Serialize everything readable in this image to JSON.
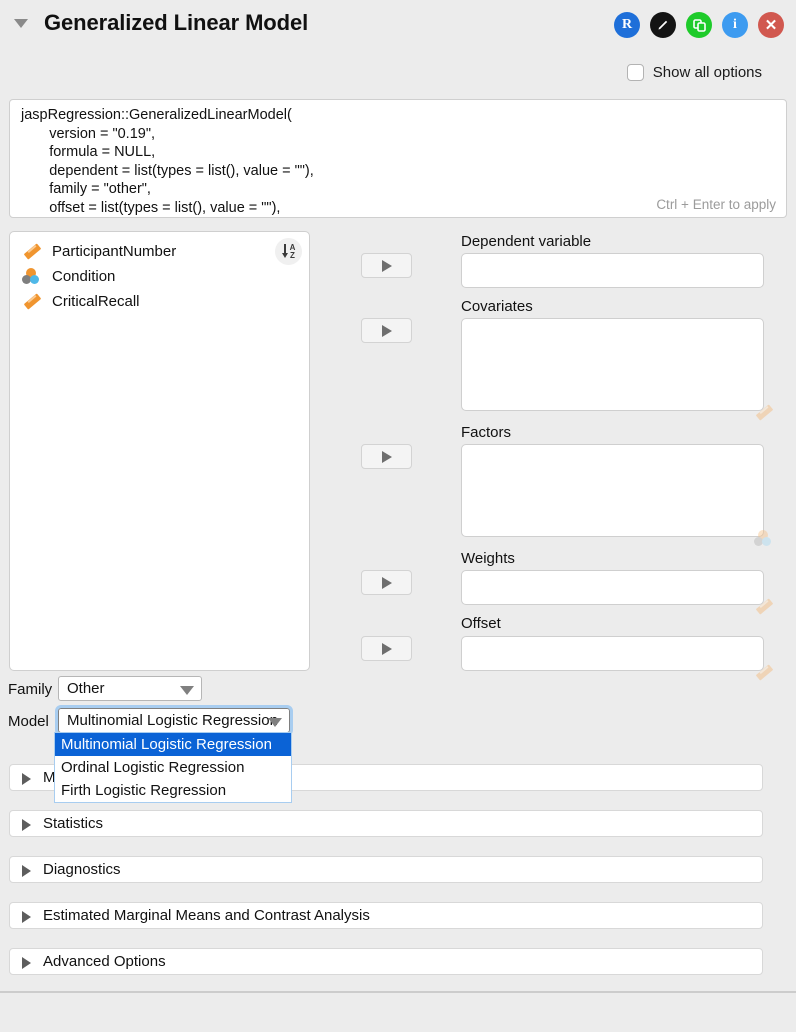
{
  "header": {
    "title": "Generalized Linear Model",
    "collapse_icon": "triangle-down-icon",
    "icons": [
      {
        "name": "r-syntax-icon",
        "glyph": "R",
        "color": "#1e6fd9"
      },
      {
        "name": "edit-pencil-icon",
        "glyph": "/",
        "color": "#141414"
      },
      {
        "name": "duplicate-icon",
        "glyph": "⧉",
        "color": "#1ecb2a"
      },
      {
        "name": "info-icon",
        "glyph": "i",
        "color": "#3d9bf0"
      },
      {
        "name": "close-icon",
        "glyph": "✕",
        "color": "#d1584f"
      }
    ]
  },
  "show_all_options": {
    "label": "Show all options",
    "checked": false
  },
  "code_editor": {
    "text": "jaspRegression::GeneralizedLinearModel(\n       version = \"0.19\",\n       formula = NULL,\n       dependent = list(types = list(), value = \"\"),\n       family = \"other\",\n       offset = list(types = list(), value = \"\"),\n       weights = list(types = list(), value = \"\"),",
    "apply_hint": "Ctrl + Enter to apply"
  },
  "variables": {
    "sort_button": "sort-az-icon",
    "items": [
      {
        "name": "ParticipantNumber",
        "icon": "scale-ruler-icon"
      },
      {
        "name": "Condition",
        "icon": "nominal-circles-icon"
      },
      {
        "name": "CriticalRecall",
        "icon": "scale-ruler-icon"
      }
    ]
  },
  "assign_buttons": [
    {
      "name": "assign-dependent-button",
      "glyph": "▶"
    },
    {
      "name": "assign-covariates-button",
      "glyph": "▶"
    },
    {
      "name": "assign-factors-button",
      "glyph": "▶"
    },
    {
      "name": "assign-weights-button",
      "glyph": "▶"
    },
    {
      "name": "assign-offset-button",
      "glyph": "▶"
    }
  ],
  "fields": [
    {
      "label": "Dependent variable",
      "value": "",
      "watermark": "scale-ruler-icon",
      "name": "dependent-variable"
    },
    {
      "label": "Covariates",
      "value": "",
      "watermark": "scale-ruler-icon",
      "name": "covariates"
    },
    {
      "label": "Factors",
      "value": "",
      "watermark": "nominal-circles-icon",
      "name": "factors"
    },
    {
      "label": "Weights",
      "value": "",
      "watermark": "scale-ruler-icon",
      "name": "weights"
    },
    {
      "label": "Offset",
      "value": "",
      "watermark": "scale-ruler-icon",
      "name": "offset"
    }
  ],
  "family": {
    "label": "Family",
    "value": "Other"
  },
  "model_select": {
    "label": "Model",
    "value": "Multinomial Logistic Regression",
    "open": true,
    "options": [
      "Multinomial Logistic Regression",
      "Ordinal Logistic Regression",
      "Firth Logistic Regression"
    ],
    "selected_index": 0
  },
  "sections": [
    {
      "label": "Model",
      "name": "section-model"
    },
    {
      "label": "Statistics",
      "name": "section-statistics"
    },
    {
      "label": "Diagnostics",
      "name": "section-diagnostics"
    },
    {
      "label": "Estimated Marginal Means and Contrast Analysis",
      "name": "section-emm"
    },
    {
      "label": "Advanced Options",
      "name": "section-advanced-options"
    }
  ],
  "colors": {
    "background": "#ececec",
    "accent_blue": "#0b63d6",
    "focus_ring": "#a8cdf0",
    "scale_orange": "#f0952f",
    "nominal_blue": "#4fb8e8"
  }
}
